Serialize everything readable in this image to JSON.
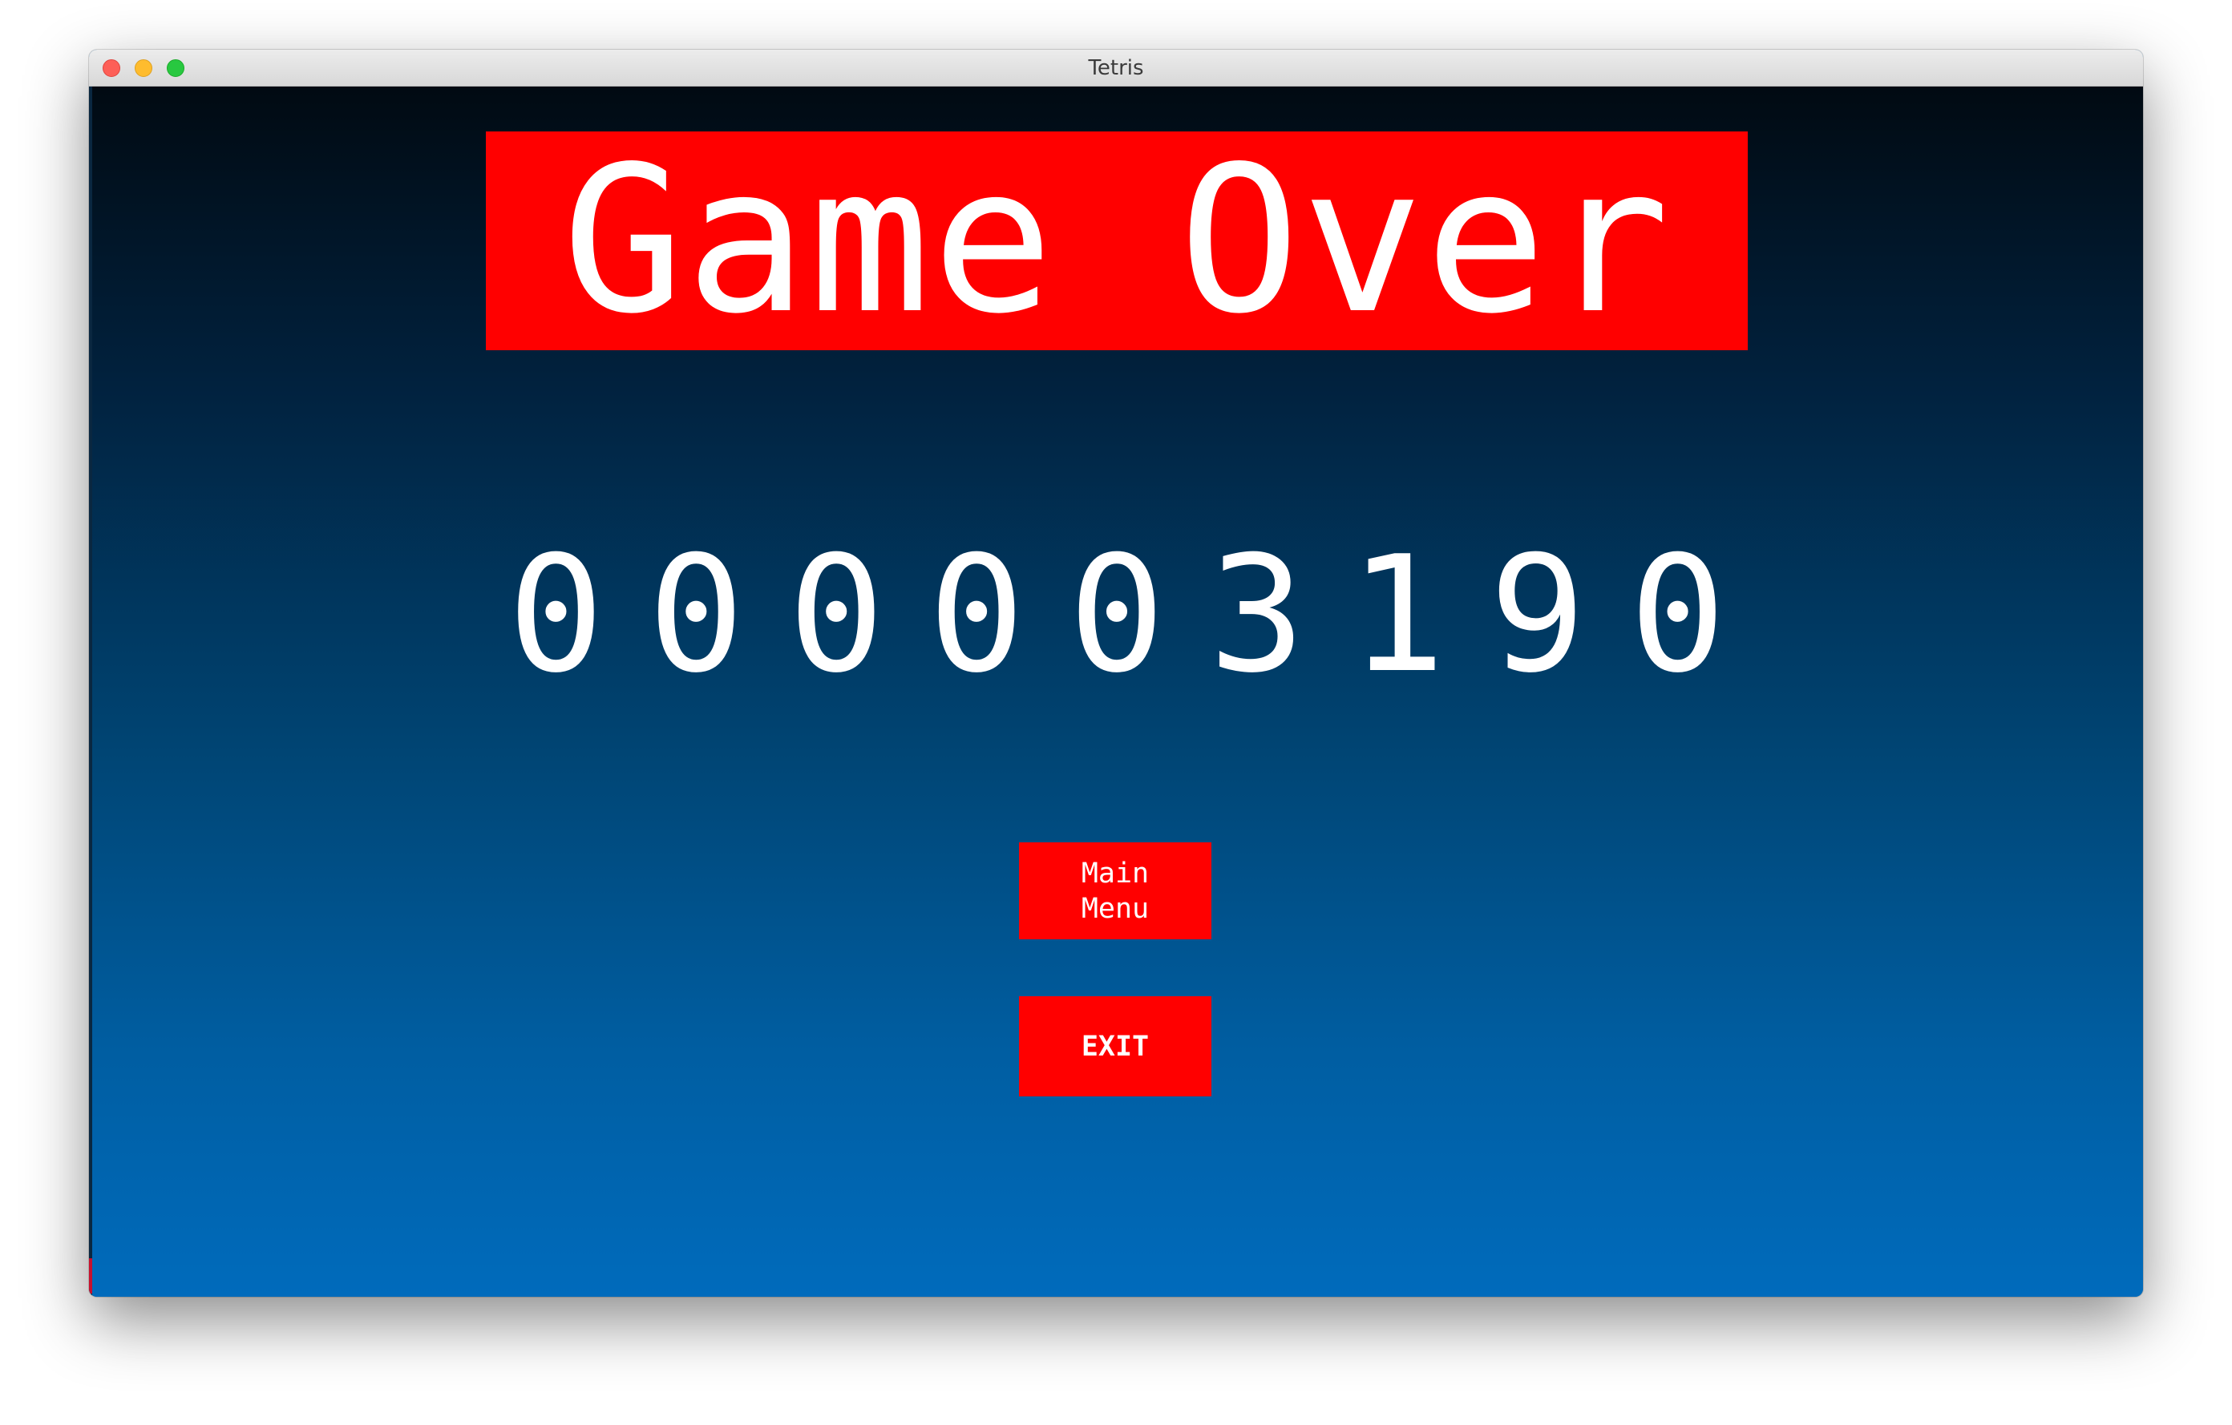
{
  "window": {
    "title": "Tetris"
  },
  "game": {
    "banner": "Game Over",
    "score_digits": [
      "0",
      "0",
      "0",
      "0",
      "0",
      "3",
      "1",
      "9",
      "0"
    ],
    "buttons": {
      "main_menu": "Main\nMenu",
      "exit": "EXIT"
    }
  },
  "colors": {
    "accent": "#ff0000",
    "text": "#ffffff",
    "background_top": "#010a12",
    "background_bottom": "#006bbc"
  }
}
